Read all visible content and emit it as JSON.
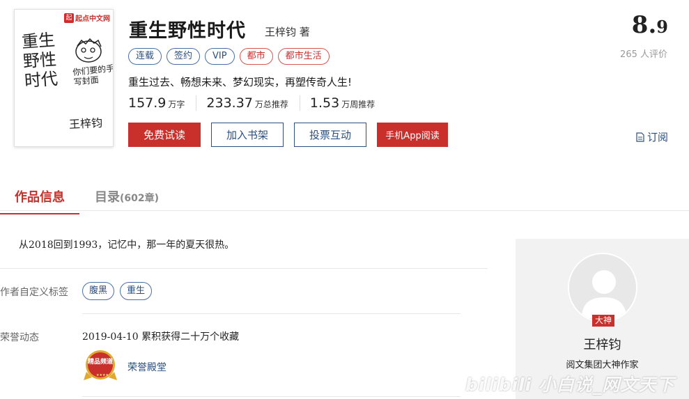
{
  "cover": {
    "logo_text": "起点中文网",
    "title_art": "重生野性时代",
    "note_art": "你们要的手写封面",
    "author_art": "王梓钧"
  },
  "book": {
    "title": "重生野性时代",
    "author": "王梓钧 著",
    "score_main": "8.",
    "score_decimal": "9",
    "reviews": "265 人评价",
    "tags": [
      {
        "label": "连载",
        "style": "blue"
      },
      {
        "label": "签约",
        "style": "blue"
      },
      {
        "label": "VIP",
        "style": "blue"
      },
      {
        "label": "都市",
        "style": "red"
      },
      {
        "label": "都市生活",
        "style": "red"
      }
    ],
    "intro": "重生过去、畅想未来、梦幻现实，再塑传奇人生!",
    "stats": [
      {
        "num": "157.9",
        "unit": "万字"
      },
      {
        "num": "233.37",
        "unit": "万总推荐"
      },
      {
        "num": "1.53",
        "unit": "万周推荐"
      }
    ]
  },
  "actions": {
    "read": "免费试读",
    "shelf": "加入书架",
    "vote": "投票互动",
    "app": "手机App阅读",
    "subscribe": "订阅"
  },
  "tabs": {
    "info": "作品信息",
    "toc": "目录",
    "toc_count": "(602章)"
  },
  "detail": {
    "description": "从2018回到1993，记忆中，那一年的夏天很热。",
    "custom_tags_label": "作者自定义标签",
    "custom_tags": [
      "腹黑",
      "重生"
    ],
    "honor_label": "荣誉动态",
    "honor_entry": "2019-04-10  累积获得二十万个收藏",
    "medal_text": "精品频道",
    "hall_link": "荣誉殿堂"
  },
  "author_card": {
    "badge": "大神",
    "name": "王梓钧",
    "title": "阅文集团大神作家"
  },
  "watermark": "bilibili 小白说_网文天下",
  "colors": {
    "accent": "#c9302c",
    "link": "#2c4f80"
  }
}
